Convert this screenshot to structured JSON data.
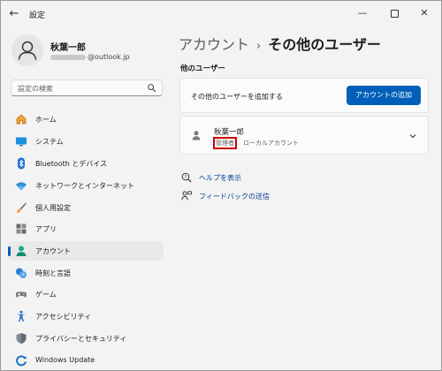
{
  "app": {
    "title": "設定"
  },
  "titlebar": {
    "back_icon": "←",
    "minimize_icon": "—",
    "close_icon": "✕"
  },
  "user": {
    "name": "秋葉一郎",
    "email_suffix": "@outlook.jp"
  },
  "search": {
    "placeholder": "設定の検索"
  },
  "sidebar": {
    "items": [
      {
        "label": "ホーム",
        "icon": "home-icon"
      },
      {
        "label": "システム",
        "icon": "system-icon"
      },
      {
        "label": "Bluetooth とデバイス",
        "icon": "bluetooth-icon"
      },
      {
        "label": "ネットワークとインターネット",
        "icon": "network-icon"
      },
      {
        "label": "個人用設定",
        "icon": "personalization-icon"
      },
      {
        "label": "アプリ",
        "icon": "apps-icon"
      },
      {
        "label": "アカウント",
        "icon": "accounts-icon",
        "active": true
      },
      {
        "label": "時刻と言語",
        "icon": "time-language-icon"
      },
      {
        "label": "ゲーム",
        "icon": "gaming-icon"
      },
      {
        "label": "アクセシビリティ",
        "icon": "accessibility-icon"
      },
      {
        "label": "プライバシーとセキュリティ",
        "icon": "privacy-icon"
      },
      {
        "label": "Windows Update",
        "icon": "windows-update-icon"
      }
    ]
  },
  "main": {
    "breadcrumb_parent": "アカウント",
    "breadcrumb_separator": "›",
    "breadcrumb_current": "その他のユーザー",
    "section_title": "他のユーザー",
    "add_user_text": "その他のユーザーを追加する",
    "add_account_button": "アカウントの追加",
    "account": {
      "name": "秋葉一郎",
      "role": "管理者",
      "type": "ローカルアカウント"
    },
    "help_link": "ヘルプを表示",
    "feedback_link": "フィードバックの送信"
  },
  "colors": {
    "accent": "#005fb8",
    "highlight_box": "#d00000",
    "background": "#f3f3f3"
  }
}
